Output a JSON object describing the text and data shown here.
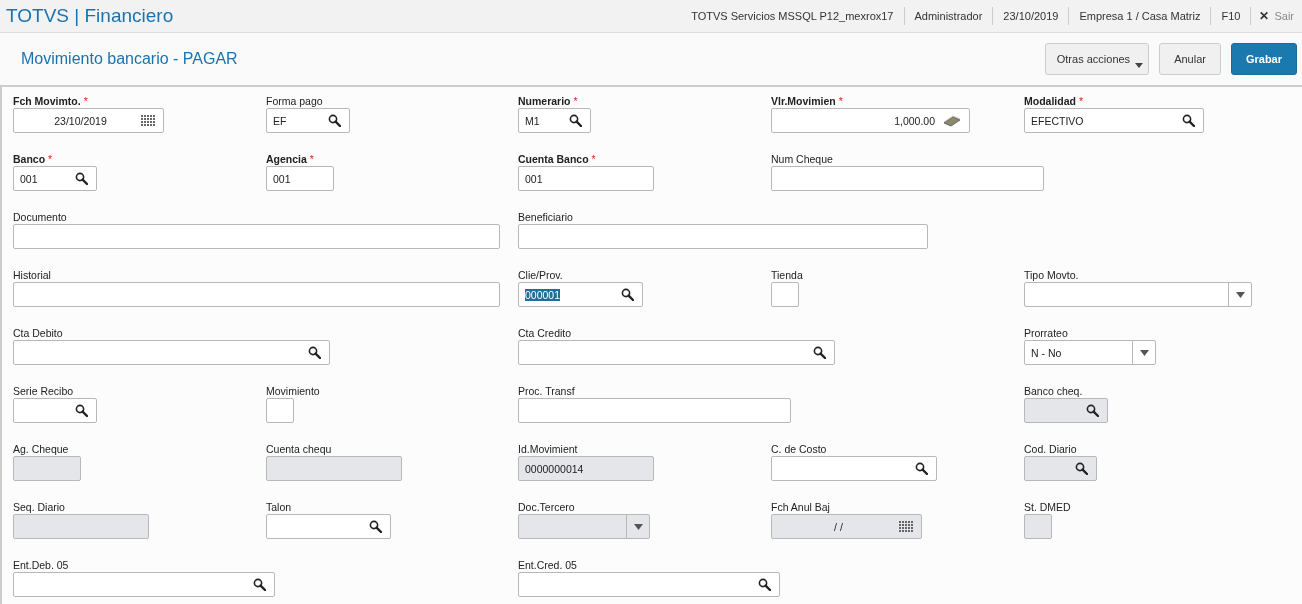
{
  "app_bar": {
    "title": "TOTVS | Financiero",
    "info": [
      "TOTVS Servicios MSSQL P12_mexrox17",
      "Administrador",
      "23/10/2019",
      "Empresa 1 / Casa Matriz",
      "F10"
    ],
    "exit": {
      "icon": "✕",
      "label": "Sair"
    }
  },
  "toolbar": {
    "title": "Movimiento bancario - PAGAR",
    "buttons": [
      {
        "label": "Otras acciones",
        "kind": "menu"
      },
      {
        "label": "Anular",
        "kind": "plain"
      },
      {
        "label": "Grabar",
        "kind": "primary"
      }
    ]
  },
  "form": {
    "rows": [
      [
        {
          "label": "Fch Movimto.",
          "required_mark": "*",
          "kind": "date",
          "value": "23/10/2019",
          "disabled": false
        },
        {
          "label": "Forma pago",
          "kind": "lookup",
          "value": "EF",
          "disabled": false
        },
        {
          "label": "Numerario",
          "required_mark": "*",
          "kind": "lookup",
          "value": "M1",
          "disabled": false
        },
        {
          "label": "Vlr.Movimien",
          "required_mark": "*",
          "kind": "money",
          "value": "1,000.00",
          "disabled": false
        },
        {
          "label": "Modalidad",
          "required_mark": "*",
          "kind": "lookup",
          "value": "EFECTIVO",
          "disabled": false
        }
      ],
      [
        {
          "label": "Banco",
          "required_mark": "*",
          "kind": "lookup",
          "value": "001",
          "disabled": false
        },
        {
          "label": "Agencia",
          "required_mark": "*",
          "kind": "text",
          "value": "001",
          "disabled": false
        },
        {
          "label": "Cuenta Banco",
          "required_mark": "*",
          "kind": "text",
          "value": "001",
          "disabled": false
        },
        {
          "label": "Num Cheque",
          "kind": "text",
          "disabled": false
        }
      ],
      [
        {
          "label": "Documento",
          "kind": "text",
          "disabled": false
        },
        "",
        {
          "label": "Beneficiario",
          "kind": "text",
          "disabled": false
        }
      ],
      [
        {
          "label": "Historial",
          "kind": "text",
          "disabled": false
        },
        "",
        {
          "label": "Clie/Prov.",
          "kind": "lookup",
          "value": "000001",
          "text_selected": true,
          "disabled": false
        },
        {
          "label": "Tienda",
          "kind": "text",
          "disabled": false
        },
        {
          "label": "Tipo Movto.",
          "kind": "select",
          "disabled": false
        }
      ],
      [
        {
          "label": "Cta Debito",
          "kind": "lookup",
          "disabled": false
        },
        "",
        {
          "label": "Cta Credito",
          "kind": "lookup",
          "disabled": false
        },
        "",
        {
          "label": "Prorrateo",
          "kind": "select",
          "value": "N - No",
          "disabled": false
        }
      ],
      [
        {
          "label": "Serie Recibo",
          "kind": "lookup",
          "disabled": false
        },
        {
          "label": "Movimiento",
          "kind": "text",
          "disabled": false
        },
        {
          "label": "Proc. Transf",
          "kind": "text",
          "disabled": false
        },
        "",
        {
          "label": "Banco cheq.",
          "kind": "lookup",
          "disabled": true
        }
      ],
      [
        {
          "label": "Ag. Cheque",
          "kind": "text",
          "disabled": true
        },
        {
          "label": "Cuenta chequ",
          "kind": "text",
          "disabled": true
        },
        {
          "label": "Id.Movimient",
          "kind": "text",
          "value": "0000000014",
          "disabled": true
        },
        {
          "label": "C. de Costo",
          "kind": "lookup",
          "disabled": false
        },
        {
          "label": "Cod. Diario",
          "kind": "lookup",
          "disabled": true
        }
      ],
      [
        {
          "label": "Seq. Diario",
          "kind": "text",
          "disabled": true
        },
        {
          "label": "Talon",
          "kind": "lookup",
          "disabled": false
        },
        {
          "label": "Doc.Tercero",
          "kind": "select",
          "disabled": true
        },
        {
          "label": "Fch Anul Baj",
          "kind": "date",
          "value": "/ /",
          "disabled": true
        },
        {
          "label": "St. DMED",
          "kind": "text",
          "disabled": true
        }
      ],
      [
        {
          "label": "Ent.Deb. 05",
          "kind": "lookup",
          "disabled": false
        },
        "",
        {
          "label": "Ent.Cred. 05",
          "kind": "lookup",
          "disabled": false
        }
      ]
    ]
  }
}
